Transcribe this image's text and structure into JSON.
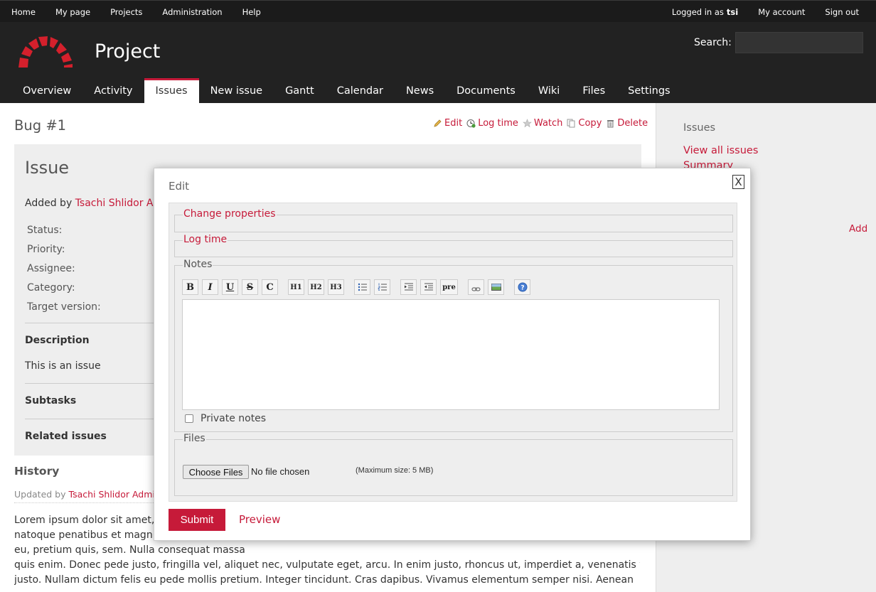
{
  "top_menu": {
    "home": "Home",
    "my_page": "My page",
    "projects": "Projects",
    "administration": "Administration",
    "help": "Help",
    "logged_in_as": "Logged in as",
    "user": "tsi",
    "my_account": "My account",
    "sign_out": "Sign out"
  },
  "header": {
    "project_title": "Project",
    "search_label": "Search:",
    "search_value": ""
  },
  "main_menu": [
    {
      "label": "Overview"
    },
    {
      "label": "Activity"
    },
    {
      "label": "Issues"
    },
    {
      "label": "New issue"
    },
    {
      "label": "Gantt"
    },
    {
      "label": "Calendar"
    },
    {
      "label": "News"
    },
    {
      "label": "Documents"
    },
    {
      "label": "Wiki"
    },
    {
      "label": "Files"
    },
    {
      "label": "Settings"
    }
  ],
  "page": {
    "heading": "Bug #1",
    "actions": {
      "edit": "Edit",
      "log_time": "Log time",
      "watch": "Watch",
      "copy": "Copy",
      "delete": "Delete"
    }
  },
  "issue": {
    "subject": "Issue",
    "added_by": "Added by",
    "author": "Tsachi Shlidor Ac",
    "status_label": "Status:",
    "priority_label": "Priority:",
    "assignee_label": "Assignee:",
    "category_label": "Category:",
    "target_version_label": "Target version:",
    "description_title": "Description",
    "description": "This is an issue",
    "subtasks_title": "Subtasks",
    "related_title": "Related issues"
  },
  "history": {
    "title": "History",
    "updated_by": "Updated by",
    "author": "Tsachi Shlidor Admin",
    "lines": [
      "Lorem ipsum dolor sit amet, c",
      "natoque penatibus et magnis",
      "eu, pretium quis, sem. Nulla consequat massa",
      "quis enim. Donec pede justo, fringilla vel, aliquet nec, vulputate eget, arcu. In enim justo, rhoncus ut, imperdiet a, venenatis vitae,",
      "justo. Nullam dictum felis eu pede mollis pretium. Integer tincidunt. Cras dapibus. Vivamus elementum semper nisi. Aenean"
    ]
  },
  "sidebar": {
    "title": "Issues",
    "view_all": "View all issues",
    "summary": "Summary",
    "add": "Add"
  },
  "modal": {
    "title": "Edit",
    "close": "X",
    "change_properties": "Change properties",
    "log_time": "Log time",
    "notes": "Notes",
    "notes_value": "",
    "toolbar": [
      "B",
      "I",
      "U",
      "S",
      "C",
      "H1",
      "H2",
      "H3",
      "ul",
      "ol",
      "indent",
      "outdent",
      "pre",
      "link",
      "image",
      "help"
    ],
    "private_notes": "Private notes",
    "files": "Files",
    "choose_files": "Choose Files",
    "no_file": "No file chosen",
    "max_size": "(Maximum size: 5 MB)",
    "submit": "Submit",
    "preview": "Preview"
  },
  "colors": {
    "accent": "#c61a39",
    "header_bg": "#222222",
    "top_menu_bg": "#1b1b1b",
    "sidebar_bg": "#eeeeee"
  }
}
